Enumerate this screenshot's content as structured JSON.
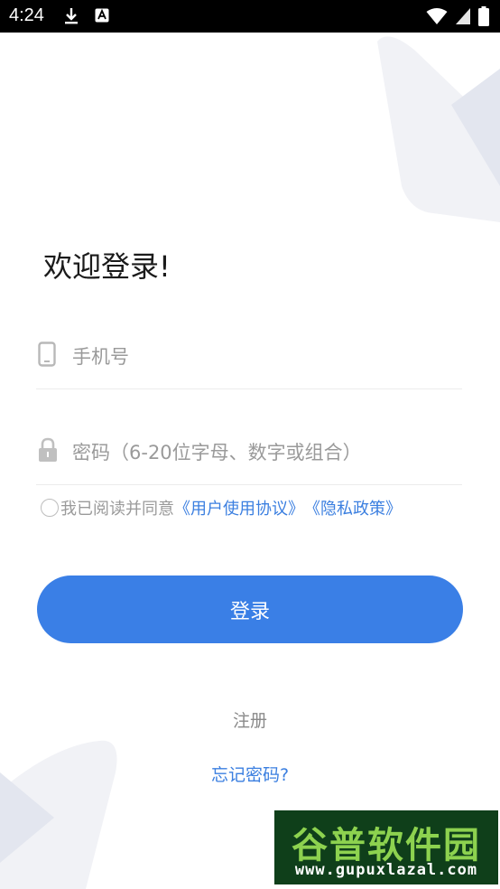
{
  "status_bar": {
    "time": "4:24",
    "icons": [
      "download-icon",
      "a-notification-icon",
      "wifi-icon",
      "signal-icon",
      "battery-icon"
    ]
  },
  "colors": {
    "accent": "#3a7fe6",
    "link": "#3b7fe0",
    "placeholder": "#9a9a9a"
  },
  "welcome": "欢迎登录!",
  "phone_field": {
    "placeholder": "手机号",
    "value": "",
    "icon": "phone-icon"
  },
  "password_field": {
    "placeholder": "密码（6-20位字母、数字或组合）",
    "value": "",
    "icon": "lock-icon"
  },
  "agreement": {
    "prefix": "我已阅读并同意",
    "user_agreement": "《用户使用协议》",
    "privacy_policy": "《隐私政策》",
    "checked": false
  },
  "login_button": "登录",
  "register_link": "注册",
  "forgot_link": "忘记密码?",
  "watermark": {
    "title": "谷普软件园",
    "url": "www.gupuxlazal.com"
  }
}
